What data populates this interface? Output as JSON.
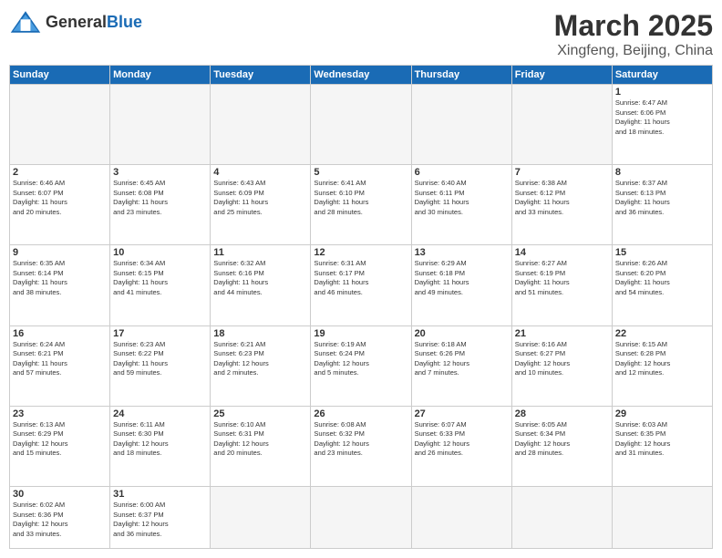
{
  "header": {
    "logo_general": "General",
    "logo_blue": "Blue",
    "title": "March 2025",
    "subtitle": "Xingfeng, Beijing, China"
  },
  "days_of_week": [
    "Sunday",
    "Monday",
    "Tuesday",
    "Wednesday",
    "Thursday",
    "Friday",
    "Saturday"
  ],
  "weeks": [
    [
      {
        "day": "",
        "info": ""
      },
      {
        "day": "",
        "info": ""
      },
      {
        "day": "",
        "info": ""
      },
      {
        "day": "",
        "info": ""
      },
      {
        "day": "",
        "info": ""
      },
      {
        "day": "",
        "info": ""
      },
      {
        "day": "1",
        "info": "Sunrise: 6:47 AM\nSunset: 6:06 PM\nDaylight: 11 hours\nand 18 minutes."
      }
    ],
    [
      {
        "day": "2",
        "info": "Sunrise: 6:46 AM\nSunset: 6:07 PM\nDaylight: 11 hours\nand 20 minutes."
      },
      {
        "day": "3",
        "info": "Sunrise: 6:45 AM\nSunset: 6:08 PM\nDaylight: 11 hours\nand 23 minutes."
      },
      {
        "day": "4",
        "info": "Sunrise: 6:43 AM\nSunset: 6:09 PM\nDaylight: 11 hours\nand 25 minutes."
      },
      {
        "day": "5",
        "info": "Sunrise: 6:41 AM\nSunset: 6:10 PM\nDaylight: 11 hours\nand 28 minutes."
      },
      {
        "day": "6",
        "info": "Sunrise: 6:40 AM\nSunset: 6:11 PM\nDaylight: 11 hours\nand 30 minutes."
      },
      {
        "day": "7",
        "info": "Sunrise: 6:38 AM\nSunset: 6:12 PM\nDaylight: 11 hours\nand 33 minutes."
      },
      {
        "day": "8",
        "info": "Sunrise: 6:37 AM\nSunset: 6:13 PM\nDaylight: 11 hours\nand 36 minutes."
      }
    ],
    [
      {
        "day": "9",
        "info": "Sunrise: 6:35 AM\nSunset: 6:14 PM\nDaylight: 11 hours\nand 38 minutes."
      },
      {
        "day": "10",
        "info": "Sunrise: 6:34 AM\nSunset: 6:15 PM\nDaylight: 11 hours\nand 41 minutes."
      },
      {
        "day": "11",
        "info": "Sunrise: 6:32 AM\nSunset: 6:16 PM\nDaylight: 11 hours\nand 44 minutes."
      },
      {
        "day": "12",
        "info": "Sunrise: 6:31 AM\nSunset: 6:17 PM\nDaylight: 11 hours\nand 46 minutes."
      },
      {
        "day": "13",
        "info": "Sunrise: 6:29 AM\nSunset: 6:18 PM\nDaylight: 11 hours\nand 49 minutes."
      },
      {
        "day": "14",
        "info": "Sunrise: 6:27 AM\nSunset: 6:19 PM\nDaylight: 11 hours\nand 51 minutes."
      },
      {
        "day": "15",
        "info": "Sunrise: 6:26 AM\nSunset: 6:20 PM\nDaylight: 11 hours\nand 54 minutes."
      }
    ],
    [
      {
        "day": "16",
        "info": "Sunrise: 6:24 AM\nSunset: 6:21 PM\nDaylight: 11 hours\nand 57 minutes."
      },
      {
        "day": "17",
        "info": "Sunrise: 6:23 AM\nSunset: 6:22 PM\nDaylight: 11 hours\nand 59 minutes."
      },
      {
        "day": "18",
        "info": "Sunrise: 6:21 AM\nSunset: 6:23 PM\nDaylight: 12 hours\nand 2 minutes."
      },
      {
        "day": "19",
        "info": "Sunrise: 6:19 AM\nSunset: 6:24 PM\nDaylight: 12 hours\nand 5 minutes."
      },
      {
        "day": "20",
        "info": "Sunrise: 6:18 AM\nSunset: 6:26 PM\nDaylight: 12 hours\nand 7 minutes."
      },
      {
        "day": "21",
        "info": "Sunrise: 6:16 AM\nSunset: 6:27 PM\nDaylight: 12 hours\nand 10 minutes."
      },
      {
        "day": "22",
        "info": "Sunrise: 6:15 AM\nSunset: 6:28 PM\nDaylight: 12 hours\nand 12 minutes."
      }
    ],
    [
      {
        "day": "23",
        "info": "Sunrise: 6:13 AM\nSunset: 6:29 PM\nDaylight: 12 hours\nand 15 minutes."
      },
      {
        "day": "24",
        "info": "Sunrise: 6:11 AM\nSunset: 6:30 PM\nDaylight: 12 hours\nand 18 minutes."
      },
      {
        "day": "25",
        "info": "Sunrise: 6:10 AM\nSunset: 6:31 PM\nDaylight: 12 hours\nand 20 minutes."
      },
      {
        "day": "26",
        "info": "Sunrise: 6:08 AM\nSunset: 6:32 PM\nDaylight: 12 hours\nand 23 minutes."
      },
      {
        "day": "27",
        "info": "Sunrise: 6:07 AM\nSunset: 6:33 PM\nDaylight: 12 hours\nand 26 minutes."
      },
      {
        "day": "28",
        "info": "Sunrise: 6:05 AM\nSunset: 6:34 PM\nDaylight: 12 hours\nand 28 minutes."
      },
      {
        "day": "29",
        "info": "Sunrise: 6:03 AM\nSunset: 6:35 PM\nDaylight: 12 hours\nand 31 minutes."
      }
    ],
    [
      {
        "day": "30",
        "info": "Sunrise: 6:02 AM\nSunset: 6:36 PM\nDaylight: 12 hours\nand 33 minutes."
      },
      {
        "day": "31",
        "info": "Sunrise: 6:00 AM\nSunset: 6:37 PM\nDaylight: 12 hours\nand 36 minutes."
      },
      {
        "day": "",
        "info": ""
      },
      {
        "day": "",
        "info": ""
      },
      {
        "day": "",
        "info": ""
      },
      {
        "day": "",
        "info": ""
      },
      {
        "day": "",
        "info": ""
      }
    ]
  ]
}
